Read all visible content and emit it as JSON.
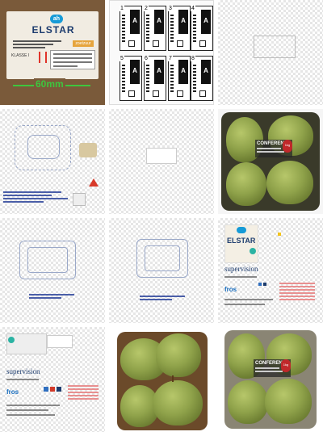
{
  "label": {
    "brand": "ELSTAR",
    "ah_logo": "ah",
    "badge": "zoetzuur",
    "klasse": "KLASSE I",
    "measure": "60mm"
  },
  "tags": [
    "1",
    "2",
    "3",
    "4",
    "5",
    "6",
    "7",
    "8"
  ],
  "tag_letter": "A",
  "photo": {
    "product": "CONFERENCE",
    "seal": "1kg"
  },
  "spec": {
    "brand": "ELSTAR",
    "title": "supervision",
    "fros": "fros"
  },
  "colors": {
    "brand_blue": "#1d3c6e",
    "ah_blue": "#179bd7",
    "measure_green": "#3ec63e",
    "accent_red": "#c0282a"
  }
}
